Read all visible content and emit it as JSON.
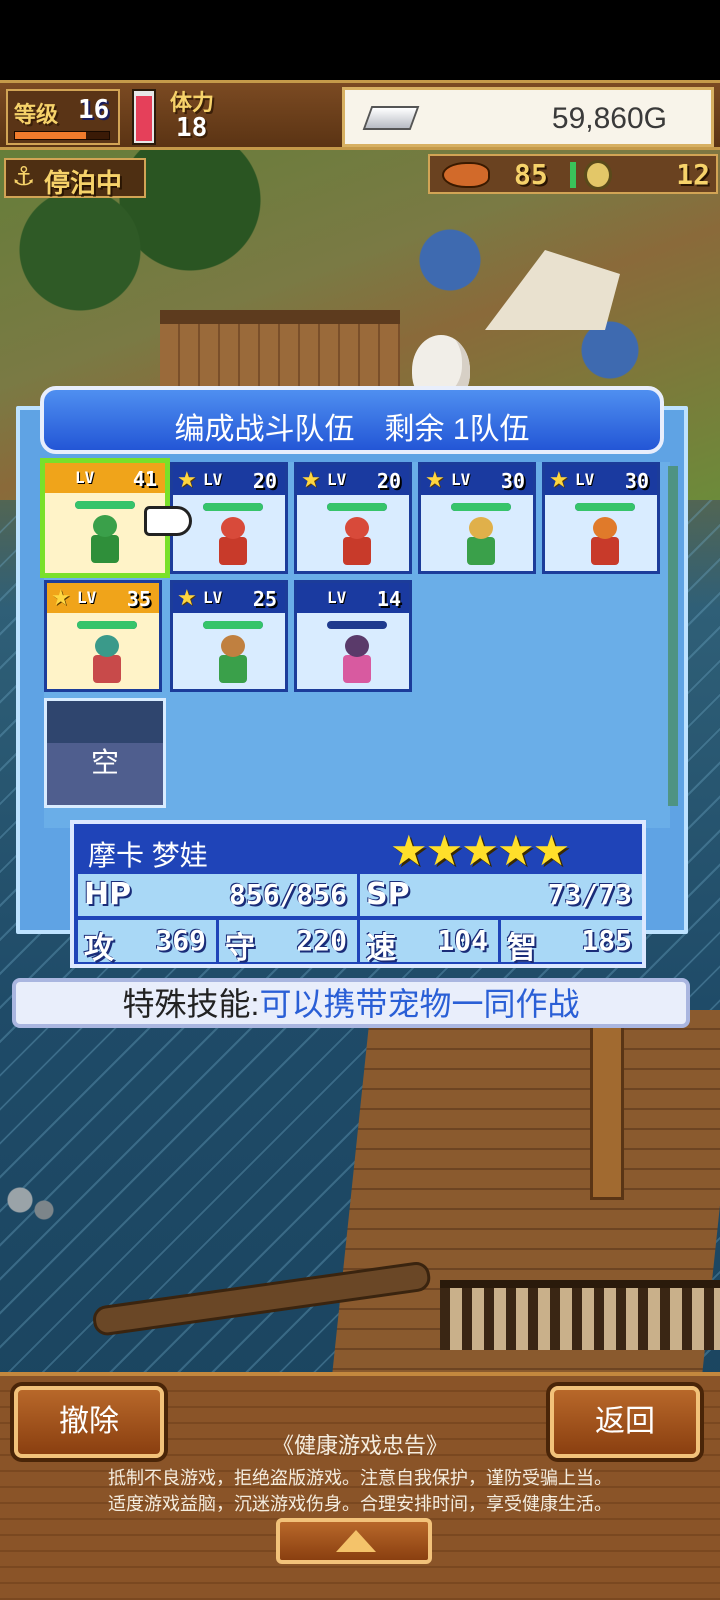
{
  "hud": {
    "level_label": "等级",
    "level": "16",
    "exp_fraction": 0.75,
    "stamina_fraction": 0.95,
    "stamina_label": "体力",
    "stamina": "18",
    "gold": "59,860G"
  },
  "status": {
    "mooring_label": "停泊中",
    "anchor_glyph": "⚓",
    "fish": "85",
    "coins": "12"
  },
  "panel": {
    "title": "编成战斗队伍　剩余 1队伍",
    "lv_text": "LV",
    "empty_label": "空"
  },
  "party": [
    {
      "lv": "41",
      "star": false,
      "gold": true,
      "selected": true,
      "hp": 1.0,
      "hp_color": "#1e3a8e",
      "head": "#3aa04a",
      "body": "#2f8f3a"
    },
    {
      "lv": "20",
      "star": true,
      "gold": false,
      "selected": false,
      "hp": 1.0,
      "head": "#d84a3a",
      "body": "#c83a2a"
    },
    {
      "lv": "20",
      "star": true,
      "gold": false,
      "selected": false,
      "hp": 1.0,
      "head": "#d84a3a",
      "body": "#c83a2a"
    },
    {
      "lv": "30",
      "star": true,
      "gold": false,
      "selected": false,
      "hp": 1.0,
      "head": "#e0b04a",
      "body": "#3aa04a"
    },
    {
      "lv": "30",
      "star": true,
      "gold": false,
      "selected": false,
      "hp": 1.0,
      "head": "#e07a2a",
      "body": "#c83a2a"
    },
    {
      "lv": "35",
      "star": true,
      "gold": true,
      "selected": false,
      "hp": 1.0,
      "head": "#3a9a8a",
      "body": "#c84a4a"
    },
    {
      "lv": "25",
      "star": true,
      "gold": false,
      "selected": false,
      "hp": 1.0,
      "head": "#c08040",
      "body": "#3aa04a"
    },
    {
      "lv": "14",
      "star": false,
      "gold": false,
      "selected": false,
      "hp": 0.0,
      "head": "#5a3a6a",
      "body": "#d85aa0"
    }
  ],
  "info": {
    "name": "摩卡 梦娃",
    "stars": "★★★★★",
    "hp_label": "HP",
    "hp": "856/856",
    "sp_label": "SP",
    "sp": "73/73",
    "atk_label": "攻",
    "atk": "369",
    "def_label": "守",
    "def": "220",
    "spd_label": "速",
    "spd": "104",
    "int_label": "智",
    "int": "185"
  },
  "skill": {
    "label": "特殊技能:",
    "value": "可以携带宠物一同作战"
  },
  "footer": {
    "remove_button": "撤除",
    "back_button": "返回",
    "notice_title": "《健康游戏忠告》",
    "notice_line1": "抵制不良游戏，拒绝盗版游戏。注意自我保护，谨防受骗上当。",
    "notice_line2": "适度游戏益脑，沉迷游戏伤身。合理安排时间，享受健康生活。"
  }
}
